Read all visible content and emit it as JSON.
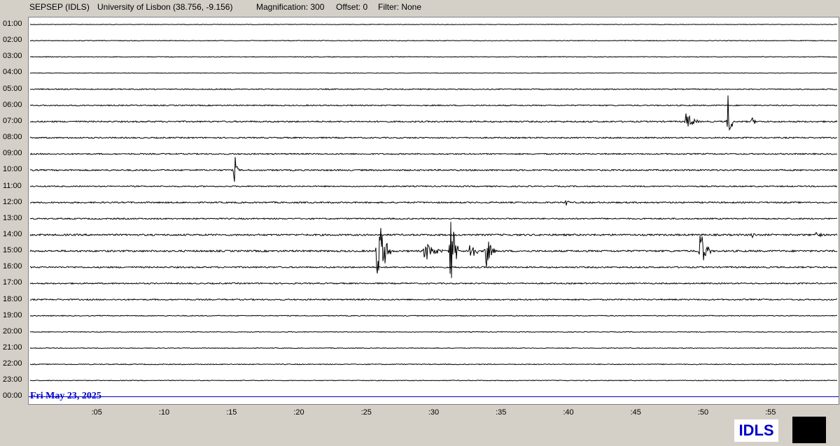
{
  "header": {
    "station": "SEPSEP (IDLS)",
    "location": "University of Lisbon (38.756, -9.156)",
    "magnification": "Magnification: 300",
    "offset": "Offset: 0",
    "filter": "Filter: None"
  },
  "rows": [
    "01:00",
    "02:00",
    "03:00",
    "04:00",
    "05:00",
    "06:00",
    "07:00",
    "08:00",
    "09:00",
    "10:00",
    "11:00",
    "12:00",
    "13:00",
    "14:00",
    "15:00",
    "16:00",
    "17:00",
    "18:00",
    "19:00",
    "20:00",
    "21:00",
    "22:00",
    "23:00",
    "00:00"
  ],
  "date_label": "Fri May 23, 2025",
  "x_ticks": [
    ":05",
    ":10",
    ":15",
    ":20",
    ":25",
    ":30",
    ":35",
    ":40",
    ":45",
    ":50",
    ":55"
  ],
  "badge": "IDLS",
  "colors": {
    "trace": "#000000",
    "current_line": "#0000cc",
    "badge_text": "#0000cc"
  },
  "chart_data": {
    "type": "line",
    "x_unit": "minutes",
    "xlim": [
      0,
      60
    ],
    "noise_levels": [
      0.4,
      0.5,
      0.5,
      0.4,
      0.7,
      0.8,
      1.0,
      0.9,
      0.9,
      1.0,
      0.8,
      1.0,
      0.9,
      1.2,
      1.2,
      1.0,
      0.9,
      0.9,
      0.6,
      0.5,
      0.5,
      0.6,
      0.5,
      0
    ],
    "events": [
      {
        "row": "07:00",
        "minute": 48.7,
        "amplitude": 14,
        "duration": 1.0
      },
      {
        "row": "07:00",
        "minute": 51.8,
        "amplitude": 45,
        "duration": 0.4
      },
      {
        "row": "07:00",
        "minute": 53.6,
        "amplitude": 6,
        "duration": 0.6
      },
      {
        "row": "10:00",
        "minute": 15.2,
        "amplitude": 22,
        "duration": 0.3
      },
      {
        "row": "12:00",
        "minute": 39.8,
        "amplitude": 8,
        "duration": 0.3
      },
      {
        "row": "14:00",
        "minute": 53.6,
        "amplitude": 7,
        "duration": 0.3
      },
      {
        "row": "14:00",
        "minute": 58.3,
        "amplitude": 7,
        "duration": 0.7
      },
      {
        "row": "15:00",
        "minute": 25.8,
        "amplitude": 60,
        "duration": 1.0
      },
      {
        "row": "15:00",
        "minute": 29.3,
        "amplitude": 16,
        "duration": 1.4
      },
      {
        "row": "15:00",
        "minute": 31.2,
        "amplitude": 65,
        "duration": 0.6
      },
      {
        "row": "15:00",
        "minute": 32.6,
        "amplitude": 30,
        "duration": 0.6
      },
      {
        "row": "15:00",
        "minute": 33.8,
        "amplitude": 30,
        "duration": 0.7
      },
      {
        "row": "15:00",
        "minute": 49.7,
        "amplitude": 35,
        "duration": 0.8
      }
    ]
  }
}
